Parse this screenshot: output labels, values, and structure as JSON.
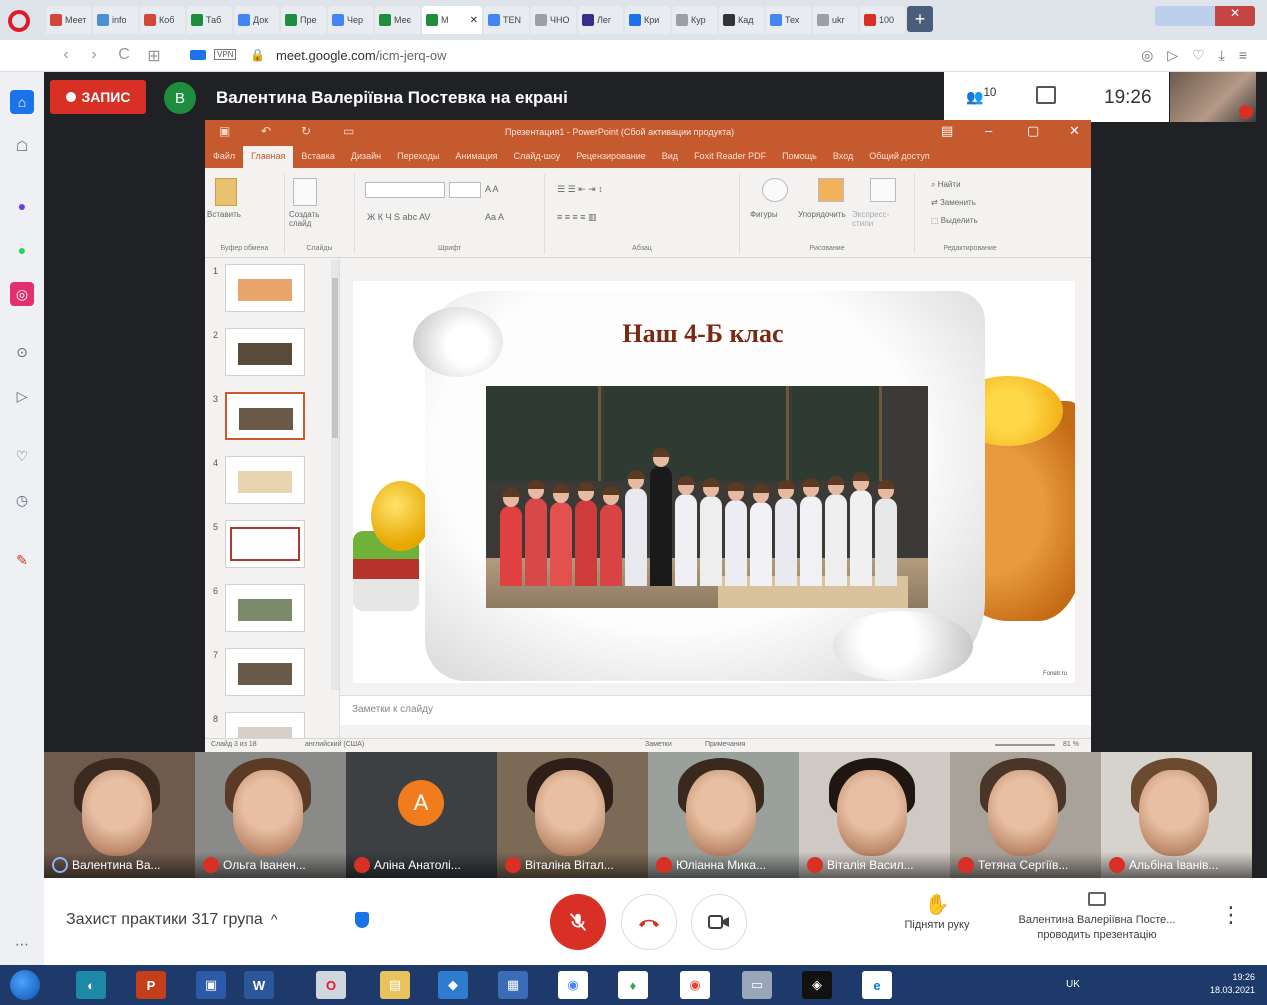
{
  "browser": {
    "tabs": [
      {
        "label": "Меет",
        "color": "#d44638"
      },
      {
        "label": "info",
        "color": "#4d8fd6"
      },
      {
        "label": "Коб",
        "color": "#d44638"
      },
      {
        "label": "Таб",
        "color": "#1e8e3e"
      },
      {
        "label": "Док",
        "color": "#4285f4"
      },
      {
        "label": "Пре",
        "color": "#1e8e3e"
      },
      {
        "label": "Чер",
        "color": "#4285f4"
      },
      {
        "label": "Меє",
        "color": "#1e8e3e"
      },
      {
        "label": "М",
        "color": "#1e8e3e",
        "active": true
      },
      {
        "label": "TEN",
        "color": "#4285f4"
      },
      {
        "label": "ЧНО",
        "color": "#9aa0a6"
      },
      {
        "label": "Лег",
        "color": "#3c2c8a"
      },
      {
        "label": "Кри",
        "color": "#1a73e8"
      },
      {
        "label": "Кур",
        "color": "#9aa0a6"
      },
      {
        "label": "Кад",
        "color": "#333333"
      },
      {
        "label": "Тех",
        "color": "#4285f4"
      },
      {
        "label": "ukr",
        "color": "#9aa0a6"
      },
      {
        "label": "100",
        "color": "#d93025"
      }
    ],
    "url_domain": "meet.google.com",
    "url_path": "/icm-jerq-ow",
    "vpn_label": "VPN"
  },
  "meet": {
    "record_label": "ЗАПИС",
    "presenter_initial": "В",
    "presenter_title": "Валентина Валеріївна Постевка на екрані",
    "people_count": "10",
    "time": "19:26",
    "meeting_name": "Захист практики 317 група",
    "raise_hand": "Підняти руку",
    "presenting_line1": "Валентина Валеріївна Посте...",
    "presenting_line2": "проводить презентацію"
  },
  "participants": [
    {
      "name": "Валентина Ва...",
      "hair": "#3a2a20",
      "bg": "#6f5a4e"
    },
    {
      "name": "Ольга Іванен...",
      "hair": "#5b3a26",
      "bg": "#8a8a88"
    },
    {
      "name": "Аліна Анатолі...",
      "initial": "А",
      "bg": "#3c4043"
    },
    {
      "name": "Віталіна Вітал...",
      "hair": "#2d1f17",
      "bg": "#7b6a55"
    },
    {
      "name": "Юліанна Мика...",
      "hair": "#3a2a1e",
      "bg": "#9aa09c"
    },
    {
      "name": "Віталія Васил...",
      "hair": "#1f1612",
      "bg": "#cfc9c3"
    },
    {
      "name": "Тетяна Сергіїв...",
      "hair": "#4a3628",
      "bg": "#a8a29a"
    },
    {
      "name": "Альбіна Іванів...",
      "hair": "#6b4a30",
      "bg": "#d6d2cc"
    }
  ],
  "ppt": {
    "title": "Презентация1 - PowerPoint (Сбой активации продукта)",
    "menus": [
      "Файл",
      "Главная",
      "Вставка",
      "Дизайн",
      "Переходы",
      "Анимация",
      "Слайд-шоу",
      "Рецензирование",
      "Вид",
      "Foxit Reader PDF",
      "Помощь",
      "Вход",
      "Общий доступ"
    ],
    "active_menu": "Главная",
    "ribbon": {
      "paste": "Вставить",
      "clipboard": "Буфер обмена",
      "new_slide": "Создать слайд",
      "slides": "Слайды",
      "font": "Шрифт",
      "paragraph": "Абзац",
      "shapes": "Фигуры",
      "arrange": "Упорядочить",
      "express": "Экспресс-стили",
      "drawing": "Рисование",
      "find": "Найти",
      "replace": "Заменить",
      "select": "Выделить",
      "editing": "Редактирование"
    },
    "thumbnails": [
      "1",
      "2",
      "3",
      "4",
      "5",
      "6",
      "7",
      "8"
    ],
    "selected_thumb": "3",
    "slide_title": "Наш 4-Б клас",
    "slide_watermark": "Fonetr.ru",
    "notes_placeholder": "Заметки к слайду",
    "status_left": "Слайд 3 из 18",
    "status_lang": "английский (США)",
    "status_notes": "Заметки",
    "status_comments": "Примечания",
    "zoom": "81 %"
  },
  "taskbar": {
    "lang": "UK",
    "time": "19:26",
    "date": "18.03.2021"
  }
}
